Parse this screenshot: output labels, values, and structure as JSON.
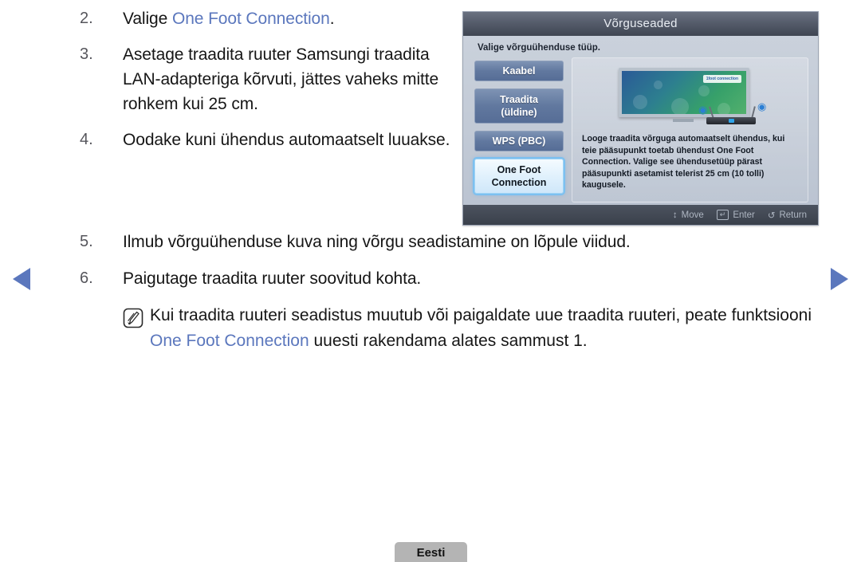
{
  "nav": {
    "prev_label": "previous-page",
    "next_label": "next-page"
  },
  "accent_color": "#5b77bd",
  "steps_upper": [
    {
      "number": "2.",
      "parts": [
        {
          "text": "Valige ",
          "highlight": false
        },
        {
          "text": "One Foot Connection",
          "highlight": true
        },
        {
          "text": ".",
          "highlight": false
        }
      ],
      "plain": "Valige One Foot Connection."
    },
    {
      "number": "3.",
      "plain": "Asetage traadita ruuter Samsungi traadita LAN-adapteriga kõrvuti, jättes vaheks mitte rohkem kui 25 cm."
    },
    {
      "number": "4.",
      "plain": "Oodake kuni ühendus automaatselt luuakse."
    }
  ],
  "steps_lower": [
    {
      "number": "5.",
      "plain": "Ilmub võrguühenduse kuva ning võrgu seadistamine on lõpule viidud."
    },
    {
      "number": "6.",
      "plain": "Paigutage traadita ruuter soovitud kohta."
    }
  ],
  "note": {
    "icon": "note-pencil-icon",
    "pre": "Kui traadita ruuteri seadistus muutub või paigaldate uue traadita ruuteri, peate funktsiooni ",
    "highlight": "One Foot Connection",
    "post": " uuesti rakendama alates sammust 1."
  },
  "osd": {
    "title": "Võrguseaded",
    "prompt": "Valige võrguühenduse tüüp.",
    "menu": [
      {
        "label": "Kaabel",
        "selected": false,
        "multiline": false
      },
      {
        "label": "Traadita\n(üldine)",
        "selected": false,
        "multiline": true
      },
      {
        "label": "WPS (PBC)",
        "selected": false,
        "multiline": false
      },
      {
        "label": "One Foot\nConnection",
        "selected": true,
        "multiline": true
      }
    ],
    "description": "Looge traadita võrguga automaatselt ühendus, kui teie pääsupunkt toetab ühendust One Foot Connection. Valige see ühendusetüüp pärast pääsupunkti asetamist telerist 25 cm (10 tolli) kaugusele.",
    "tv_logo": "1foot connection",
    "footer": [
      {
        "icon": "updown-arrows-icon",
        "glyph": "↕",
        "label": "Move"
      },
      {
        "icon": "enter-key-icon",
        "glyph": "↵",
        "label": "Enter"
      },
      {
        "icon": "return-arrow-icon",
        "glyph": "↺",
        "label": "Return"
      }
    ]
  },
  "language_button": {
    "label": "Eesti"
  }
}
